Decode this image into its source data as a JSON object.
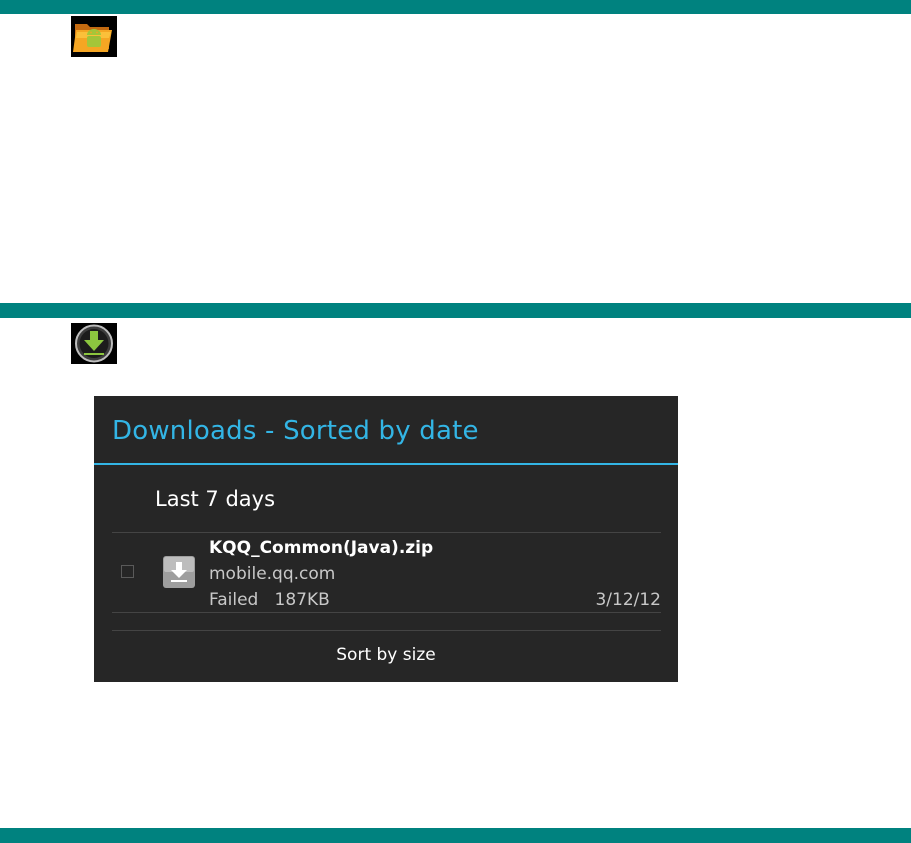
{
  "icons": {
    "folder": "android-folder-icon",
    "download": "download-icon",
    "file": "download-file-icon"
  },
  "colors": {
    "band": "#00827f",
    "panel_bg": "#262626",
    "accent": "#33b5e5"
  },
  "dialog": {
    "title": "Downloads - Sorted by date",
    "section_header": "Last 7 days",
    "item": {
      "name": "KQQ_Common(Java).zip",
      "host": "mobile.qq.com",
      "status": "Failed   187KB",
      "date": "3/12/12"
    },
    "sort_button": "Sort by size"
  }
}
